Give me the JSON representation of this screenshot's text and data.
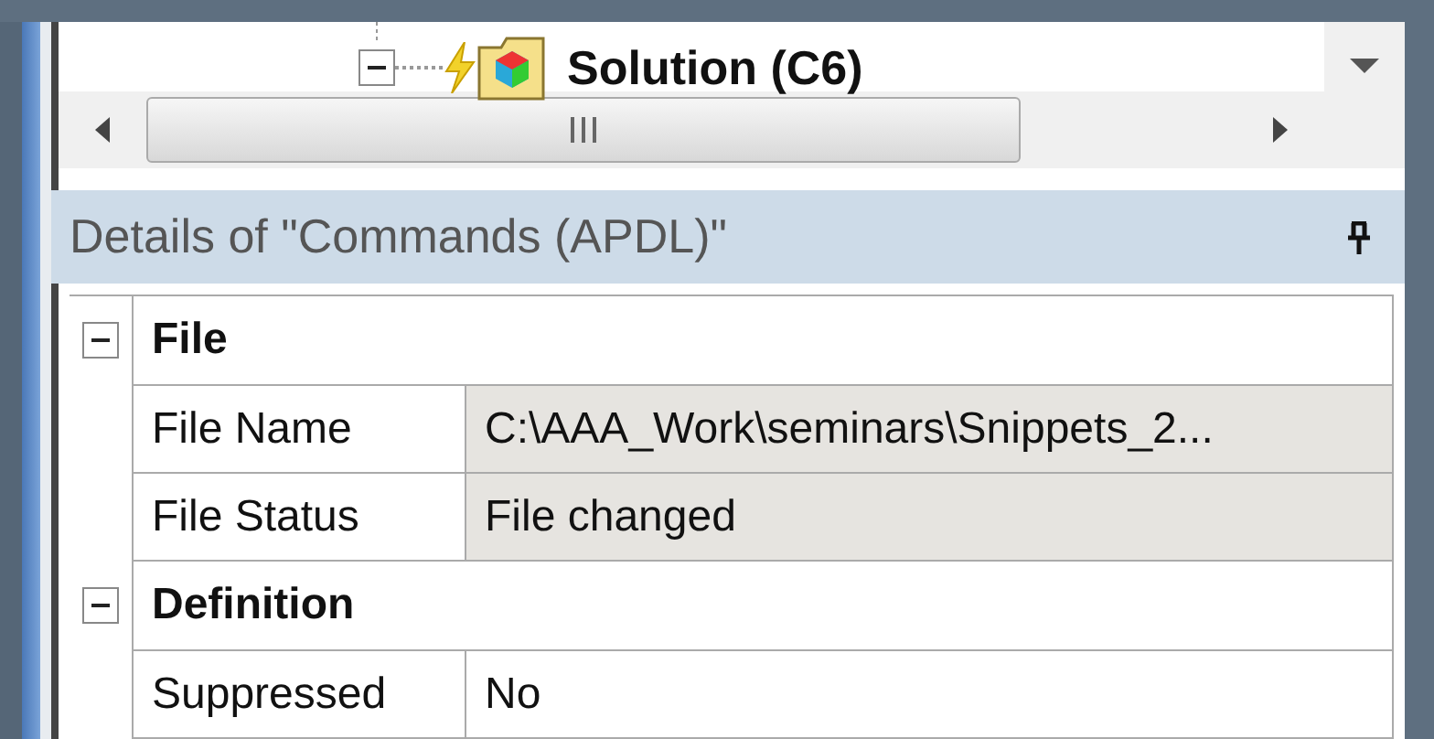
{
  "tree": {
    "items": [
      {
        "label": "Solution (C6)",
        "expanded": true
      }
    ]
  },
  "details": {
    "title": "Details of \"Commands (APDL)\"",
    "sections": [
      {
        "title": "File",
        "expanded": true,
        "rows": [
          {
            "label": "File Name",
            "value": "C:\\AAA_Work\\seminars\\Snippets_2...",
            "readonly": true
          },
          {
            "label": "File Status",
            "value": "File changed",
            "readonly": true
          }
        ]
      },
      {
        "title": "Definition",
        "expanded": true,
        "rows": [
          {
            "label": "Suppressed",
            "value": "No",
            "readonly": false
          }
        ]
      }
    ]
  }
}
